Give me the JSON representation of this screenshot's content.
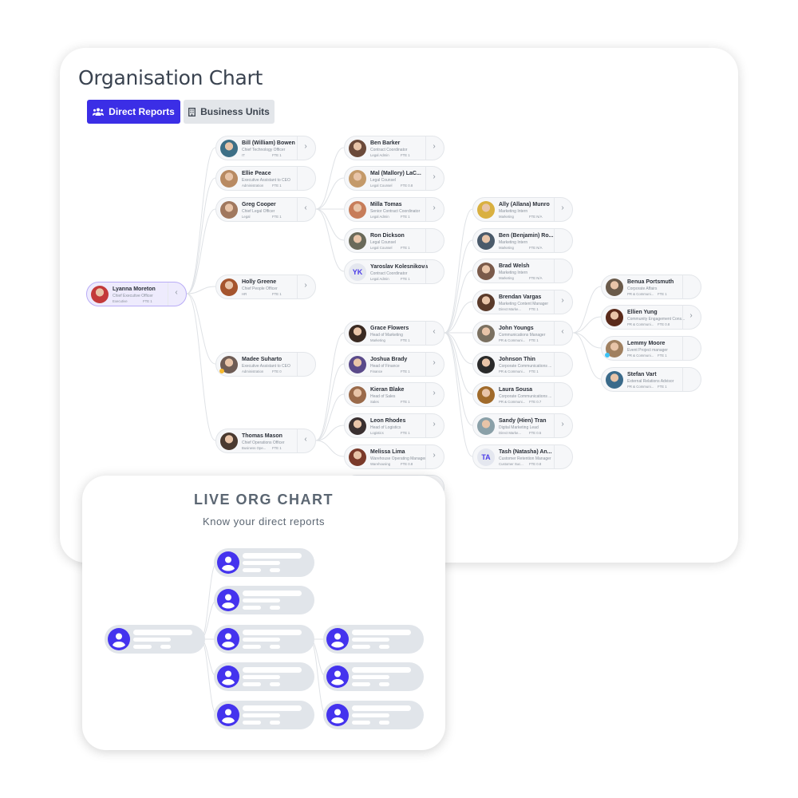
{
  "header": {
    "title": "Organisation Chart"
  },
  "tabs": [
    {
      "label": "Direct Reports",
      "icon": "people-icon",
      "active": true
    },
    {
      "label": "Business Units",
      "icon": "building-icon",
      "active": false
    }
  ],
  "colors": {
    "accent": "#3b2ee6",
    "root_bg": "#eeebfd",
    "root_border": "#b9acf6",
    "node_bg": "#f6f7f9",
    "skeleton": "#e1e5ea",
    "skeleton_avatar": "#4433ee",
    "status_away": "#f5b82e",
    "status_online": "#3ec3f5"
  },
  "org": [
    {
      "id": 0,
      "name": "Lyanna Moreton",
      "title": "Chief Executive Officer",
      "dept": "Executive",
      "fte": "FTE 1",
      "chevron": "left",
      "reports_to": null,
      "avatar_color": "#c33a3a"
    },
    {
      "id": 1,
      "name": "Bill (William) Bowen",
      "title": "Chief Technology Officer",
      "dept": "IT",
      "fte": "FTE 1",
      "chevron": "right",
      "reports_to": 0,
      "avatar_color": "#3d6f86"
    },
    {
      "id": 2,
      "name": "Ellie Peace",
      "title": "Executive Assistant to CEO",
      "dept": "Administration",
      "fte": "FTE 1",
      "chevron": "",
      "reports_to": 0,
      "avatar_color": "#b88a62"
    },
    {
      "id": 3,
      "name": "Greg Cooper",
      "title": "Chief Legal Officer",
      "dept": "Legal",
      "fte": "FTE 1",
      "chevron": "left",
      "reports_to": 0,
      "avatar_color": "#a0785e"
    },
    {
      "id": 4,
      "name": "Holly Greene",
      "title": "Chief People Officer",
      "dept": "HR",
      "fte": "FTE 1",
      "chevron": "right",
      "reports_to": 0,
      "avatar_color": "#a5552e"
    },
    {
      "id": 5,
      "name": "Madee Suharto",
      "title": "Executive Assistant to CEO",
      "dept": "Administration",
      "fte": "FTE 0",
      "chevron": "",
      "reports_to": 0,
      "avatar_color": "#6e5c55",
      "status": "away"
    },
    {
      "id": 6,
      "name": "Thomas Mason",
      "title": "Chief Operations Officer",
      "dept": "Business Ope...",
      "fte": "FTE 1",
      "chevron": "left",
      "reports_to": 0,
      "avatar_color": "#4a3a30"
    },
    {
      "id": 7,
      "name": "Ben Barker",
      "title": "Contract Coordinator",
      "dept": "Legal Admin",
      "fte": "FTE 1",
      "chevron": "right",
      "reports_to": 3,
      "avatar_color": "#6b4a3a"
    },
    {
      "id": 8,
      "name": "Mal (Mallory) LaC...",
      "title": "Legal Counsel",
      "dept": "Legal Counsel",
      "fte": "FTE 0.8",
      "chevron": "right",
      "reports_to": 3,
      "avatar_color": "#c49a6a"
    },
    {
      "id": 9,
      "name": "Milla Tomas",
      "title": "Senior Contract Coordinator",
      "dept": "Legal Admin",
      "fte": "FTE 1",
      "chevron": "right",
      "reports_to": 3,
      "avatar_color": "#c77d5a"
    },
    {
      "id": 10,
      "name": "Ron Dickson",
      "title": "Legal Counsel",
      "dept": "Legal Counsel",
      "fte": "FTE 1",
      "chevron": "",
      "reports_to": 3,
      "avatar_color": "#6a6a5a"
    },
    {
      "id": 11,
      "name": "Yaroslav Kolesnikova",
      "title": "Contract Coordinator",
      "dept": "Legal Admin",
      "fte": "FTE 1",
      "chevron": "",
      "reports_to": 3,
      "initials": "YK"
    },
    {
      "id": 12,
      "name": "Grace Flowers",
      "title": "Head of Marketing",
      "dept": "Marketing",
      "fte": "FTE 1",
      "chevron": "left",
      "reports_to": 6,
      "avatar_color": "#3a2a22"
    },
    {
      "id": 13,
      "name": "Joshua Brady",
      "title": "Head of Finance",
      "dept": "Finance",
      "fte": "FTE 1",
      "chevron": "right",
      "reports_to": 6,
      "avatar_color": "#5a4a8a"
    },
    {
      "id": 14,
      "name": "Kieran Blake",
      "title": "Head of Sales",
      "dept": "Sales",
      "fte": "FTE 1",
      "chevron": "right",
      "reports_to": 6,
      "avatar_color": "#9a6a4a"
    },
    {
      "id": 15,
      "name": "Leon Rhodes",
      "title": "Head of Logistics",
      "dept": "Logistics",
      "fte": "FTE 1",
      "chevron": "right",
      "reports_to": 6,
      "avatar_color": "#3a3030"
    },
    {
      "id": 16,
      "name": "Melissa Lima",
      "title": "Warehouse Operating Manager",
      "dept": "Warehousing",
      "fte": "FTE 0.8",
      "chevron": "right",
      "reports_to": 6,
      "avatar_color": "#7a3a2a"
    },
    {
      "id": 17,
      "name": "Ally (Allana) Munro",
      "title": "Marketing Intern",
      "dept": "Marketing",
      "fte": "FTE N/A",
      "chevron": "right",
      "reports_to": 12,
      "avatar_color": "#d9b040"
    },
    {
      "id": 18,
      "name": "Ben (Benjamin) Ro...",
      "title": "Marketing Intern",
      "dept": "Marketing",
      "fte": "FTE N/A",
      "chevron": "",
      "reports_to": 12,
      "avatar_color": "#4a5a6a"
    },
    {
      "id": 19,
      "name": "Brad Welsh",
      "title": "Marketing Intern",
      "dept": "Marketing",
      "fte": "FTE N/A",
      "chevron": "",
      "reports_to": 12,
      "avatar_color": "#7a5a4a"
    },
    {
      "id": 20,
      "name": "Brendan Vargas",
      "title": "Marketing Content Manager",
      "dept": "Direct Marke...",
      "fte": "FTE 1",
      "chevron": "right",
      "reports_to": 12,
      "avatar_color": "#5a3a2a"
    },
    {
      "id": 21,
      "name": "John Youngs",
      "title": "Communications Manager",
      "dept": "PR & Communi...",
      "fte": "FTE 1",
      "chevron": "left",
      "reports_to": 12,
      "avatar_color": "#7a7060"
    },
    {
      "id": 22,
      "name": "Johnson Thin",
      "title": "Corporate Communications ...",
      "dept": "PR & Communi...",
      "fte": "FTE 1",
      "chevron": "",
      "reports_to": 12,
      "avatar_color": "#2a2a2a"
    },
    {
      "id": 23,
      "name": "Laura Sousa",
      "title": "Corporate Communications ...",
      "dept": "PR & Communi...",
      "fte": "FTE 0.7",
      "chevron": "",
      "reports_to": 12,
      "avatar_color": "#a06a2a"
    },
    {
      "id": 24,
      "name": "Sandy (Hien) Tran",
      "title": "Digital Marketing Lead",
      "dept": "Direct Marke...",
      "fte": "FTE 0.5",
      "chevron": "right",
      "reports_to": 12,
      "avatar_color": "#8aa0a8"
    },
    {
      "id": 25,
      "name": "Tash (Natasha) An...",
      "title": "Customer Retention Manager",
      "dept": "Customer Suc...",
      "fte": "FTE 0.8",
      "chevron": "",
      "reports_to": 12,
      "initials": "TA"
    },
    {
      "id": 26,
      "name": "Benua Portsmuth",
      "title": "Corporate Affairs",
      "dept": "PR & Communi...",
      "fte": "FTE 1",
      "chevron": "",
      "reports_to": 21,
      "avatar_color": "#6a5a4a"
    },
    {
      "id": 27,
      "name": "Ellien Yung",
      "title": "Community Engagement Cons...",
      "dept": "PR & Communi...",
      "fte": "FTE 0.8",
      "chevron": "right",
      "reports_to": 21,
      "avatar_color": "#5a2a1a"
    },
    {
      "id": 28,
      "name": "Lemmy Moore",
      "title": "Event Project manager",
      "dept": "PR & Communi...",
      "fte": "FTE 1",
      "chevron": "",
      "reports_to": 21,
      "avatar_color": "#a08060",
      "status": "online"
    },
    {
      "id": 29,
      "name": "Stefan Vart",
      "title": "External Relations Advisor",
      "dept": "PR & Communi...",
      "fte": "FTE 1",
      "chevron": "",
      "reports_to": 21,
      "avatar_color": "#3a6a8a"
    }
  ],
  "promo": {
    "title": "LIVE ORG CHART",
    "subtitle": "Know your direct reports"
  }
}
